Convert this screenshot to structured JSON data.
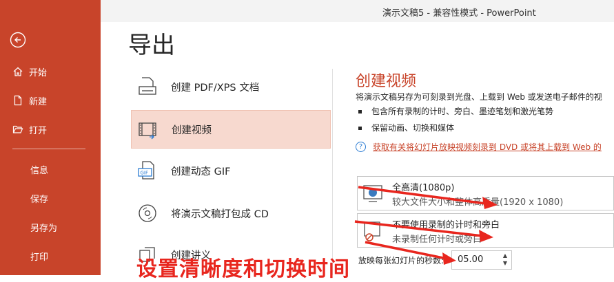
{
  "window": {
    "title": "演示文稿5 - 兼容性模式 - PowerPoint"
  },
  "sidebar": {
    "back_icon": "back-arrow-icon",
    "items": [
      {
        "label": "开始",
        "icon": "home-icon"
      },
      {
        "label": "新建",
        "icon": "new-document-icon"
      },
      {
        "label": "打开",
        "icon": "folder-open-icon"
      },
      {
        "label": "信息"
      },
      {
        "label": "保存"
      },
      {
        "label": "另存为"
      },
      {
        "label": "打印"
      }
    ]
  },
  "page": {
    "title": "导出"
  },
  "export_options": [
    {
      "label": "创建 PDF/XPS 文档",
      "icon": "pdf-document-icon",
      "selected": false
    },
    {
      "label": "创建视频",
      "icon": "video-film-icon",
      "selected": true
    },
    {
      "label": "创建动态 GIF",
      "icon": "gif-file-icon",
      "selected": false
    },
    {
      "label": "将演示文稿打包成 CD",
      "icon": "cd-disc-icon",
      "selected": false
    },
    {
      "label": "创建讲义",
      "icon": "handout-icon",
      "selected": false
    }
  ],
  "detail": {
    "title": "创建视频",
    "description": "将演示文稿另存为可刻录到光盘、上载到 Web 或发送电子邮件的视",
    "bullets": [
      "包含所有录制的计时、旁白、墨迹笔划和激光笔势",
      "保留动画、切换和媒体"
    ],
    "help_link": "获取有关将幻灯片放映视频刻录到 DVD 或将其上载到 Web 的",
    "quality": {
      "title": "全高清(1080p)",
      "subtitle": "较大文件大小和整体高质量(1920 x 1080)"
    },
    "timing": {
      "title": "不要使用录制的计时和旁白",
      "subtitle": "未录制任何计时或旁白"
    },
    "seconds_label": "放映每张幻灯片的秒数:",
    "seconds_value": "05.00"
  },
  "annotation": {
    "text": "设置清晰度和切换时间",
    "color": "#e8261e"
  },
  "colors": {
    "accent": "#c8442a",
    "selected_bg": "#f7d9cf",
    "link": "#2b7cd3"
  }
}
